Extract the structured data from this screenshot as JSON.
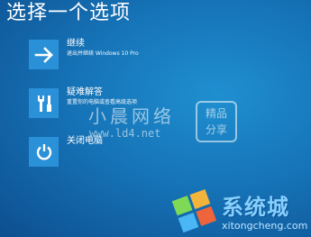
{
  "screen": {
    "title": "选择一个选项"
  },
  "options": [
    {
      "icon": "arrow-right-icon",
      "title": "继续",
      "description": "退出并继续 Windows 10 Pro"
    },
    {
      "icon": "tools-icon",
      "title": "疑难解答",
      "description": "重置你的电脑或查看高级选项"
    },
    {
      "icon": "power-icon",
      "title": "关闭电脑",
      "description": ""
    }
  ],
  "watermarks": {
    "site_name": "小晨网络",
    "site_url": "www.ld4.net",
    "badge_line1": "精品",
    "badge_line2": "分享",
    "logo_text": "系统城",
    "logo_url": "xitongcheng.com"
  },
  "colors": {
    "background": "#1674b8",
    "tile": "#2a91d8",
    "text": "#ffffff"
  }
}
